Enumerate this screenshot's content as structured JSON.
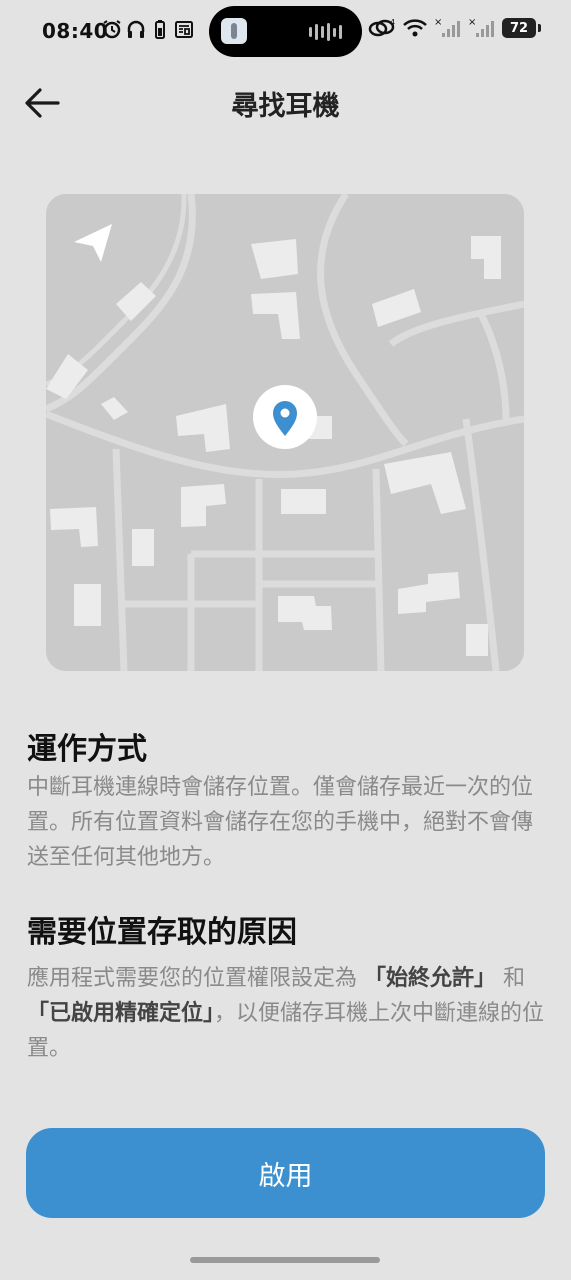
{
  "status_bar": {
    "time": "08:40",
    "battery": "72",
    "icons_left": [
      "alarm-icon",
      "headphones-icon",
      "battery-saver-icon",
      "news-icon"
    ],
    "icons_right": [
      "link-icon",
      "wifi-icon",
      "signal-icon",
      "signal-icon"
    ]
  },
  "header": {
    "title": "尋找耳機",
    "back_icon": "arrow-left-icon"
  },
  "map": {
    "pin_color": "#3d8fd0",
    "location_arrow_icon": "navigation-arrow-icon"
  },
  "section1": {
    "heading": "運作方式",
    "body": "中斷耳機連線時會儲存位置。僅會儲存最近一次的位置。所有位置資料會儲存在您的手機中，絕對不會傳送至任何其他地方。"
  },
  "section2": {
    "heading": "需要位置存取的原因",
    "body_part1": "應用程式需要您的位置權限設定為",
    "body_bold1": "「始終允許」",
    "body_part2": "和",
    "body_bold2": "「已啟用精確定位」",
    "body_part3": "，以便儲存耳機上次中斷連線的位置。"
  },
  "button": {
    "label": "啟用"
  },
  "colors": {
    "background": "#e3e3e3",
    "accent": "#3d90d0",
    "map": "#cacaca"
  }
}
